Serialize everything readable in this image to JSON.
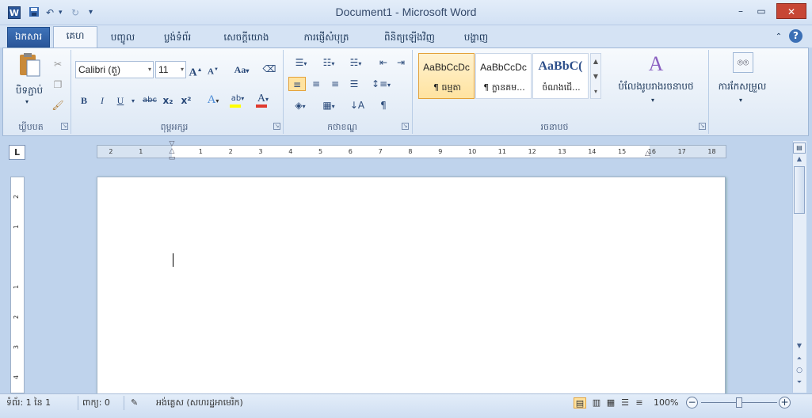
{
  "window": {
    "title": "Document1 - Microsoft Word",
    "app_logo": "W",
    "minimize": "–",
    "maximize": "▭",
    "close": "✕"
  },
  "qat": {
    "save_icon": "floppy-icon",
    "undo": "↶",
    "redo": "↻",
    "customize": "▾"
  },
  "tabs": [
    {
      "label": "ឯកសារ",
      "active": false,
      "file": true
    },
    {
      "label": "គេហ",
      "active": true
    },
    {
      "label": "បញ្ចូល"
    },
    {
      "label": "ប្លង់ទំព័រ"
    },
    {
      "label": "សេចក្តីយោង"
    },
    {
      "label": "ការផ្ញើសំបុត្រ"
    },
    {
      "label": "ពិនិត្យឡើងវិញ"
    },
    {
      "label": "បង្ហាញ"
    }
  ],
  "ribbon": {
    "clipboard": {
      "label": "ឃ្លីបបត",
      "paste": "បិទភ្ជាប់"
    },
    "font": {
      "label": "ពុម្ពអក្សរ",
      "font_name": "Calibri (តួ)",
      "font_size": "11",
      "bold": "B",
      "italic": "I",
      "underline": "U",
      "strike": "abc",
      "subscript": "x₂",
      "superscript": "x²",
      "grow": "A",
      "shrink": "A",
      "case": "Aa"
    },
    "paragraph": {
      "label": "កថាខណ្ឌ",
      "pilcrow": "¶"
    },
    "styles": {
      "label": "រចនាបថ",
      "items": [
        {
          "preview": "AaBbCcDc",
          "name": "¶ ធម្មតា",
          "selected": true
        },
        {
          "preview": "AaBbCcDc",
          "name": "¶ ក្លានគម...",
          "selected": false
        },
        {
          "preview": "AaBbC(",
          "name": "ចំណងជើ...",
          "selected": false
        }
      ],
      "change_styles": "បំលែងរូបរាងរចនាបថ"
    },
    "editing": {
      "label": "ការកែសម្រួល"
    }
  },
  "ruler": {
    "tab_selector": "L",
    "h_ticks": [
      "2",
      "1",
      "1",
      "2",
      "3",
      "4",
      "5",
      "6",
      "7",
      "8",
      "9",
      "10",
      "11",
      "12",
      "13",
      "14",
      "15",
      "16",
      "17",
      "18"
    ],
    "v_ticks": [
      "2",
      "1",
      "1",
      "2",
      "3",
      "4"
    ]
  },
  "status": {
    "page": "ទំព័រ: 1 នៃ 1",
    "words": "ពាក្យ: 0",
    "language": "អង់គ្លេស (សហរដ្ឋអាមេរិក)",
    "zoom": "100%",
    "zoom_out": "−",
    "zoom_in": "+"
  },
  "colors": {
    "accent": "#2a5699",
    "highlight": "#ffe3a0",
    "close_red": "#c74635"
  }
}
